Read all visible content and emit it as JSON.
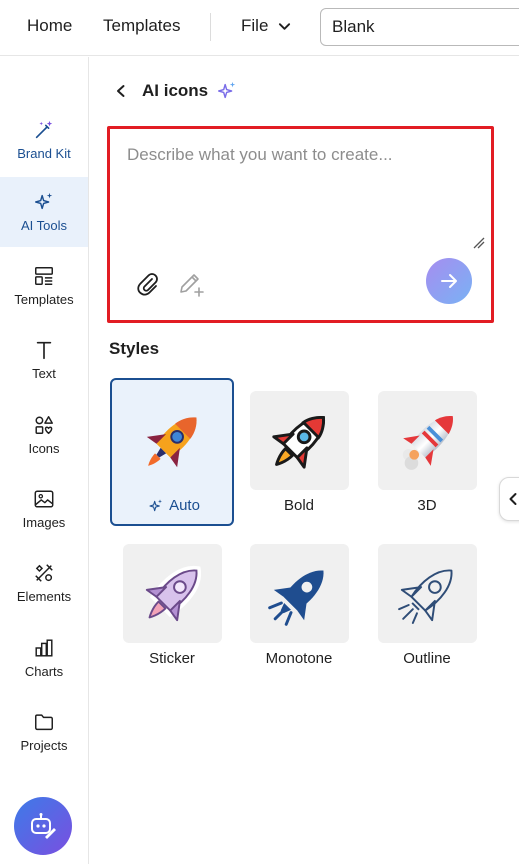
{
  "topbar": {
    "home": "Home",
    "templates": "Templates",
    "file": "File",
    "doc_name": "Blank"
  },
  "rail": {
    "items": [
      {
        "label": "Brand Kit",
        "icon": "magic-wand-icon"
      },
      {
        "label": "AI Tools",
        "icon": "sparkles-icon",
        "active": true
      },
      {
        "label": "Templates",
        "icon": "templates-icon"
      },
      {
        "label": "Text",
        "icon": "text-icon"
      },
      {
        "label": "Icons",
        "icon": "shapes-icon"
      },
      {
        "label": "Images",
        "icon": "image-icon"
      },
      {
        "label": "Elements",
        "icon": "elements-icon"
      },
      {
        "label": "Charts",
        "icon": "bar-chart-icon"
      },
      {
        "label": "Projects",
        "icon": "folder-icon"
      }
    ],
    "assistant_icon": "ai-bot-icon"
  },
  "panel": {
    "title": "AI icons",
    "prompt_placeholder": "Describe what you want to create...",
    "prompt_value": "",
    "styles_title": "Styles",
    "styles": [
      {
        "label": "Auto",
        "selected": true
      },
      {
        "label": "Bold"
      },
      {
        "label": "3D"
      },
      {
        "label": "Sticker"
      },
      {
        "label": "Monotone"
      },
      {
        "label": "Outline"
      }
    ]
  },
  "colors": {
    "accent": "#1b4f91",
    "highlight_border": "#e21c23",
    "active_bg": "#e9f1fb",
    "send_gradient_start": "#a68df0",
    "send_gradient_end": "#79b2f4"
  }
}
